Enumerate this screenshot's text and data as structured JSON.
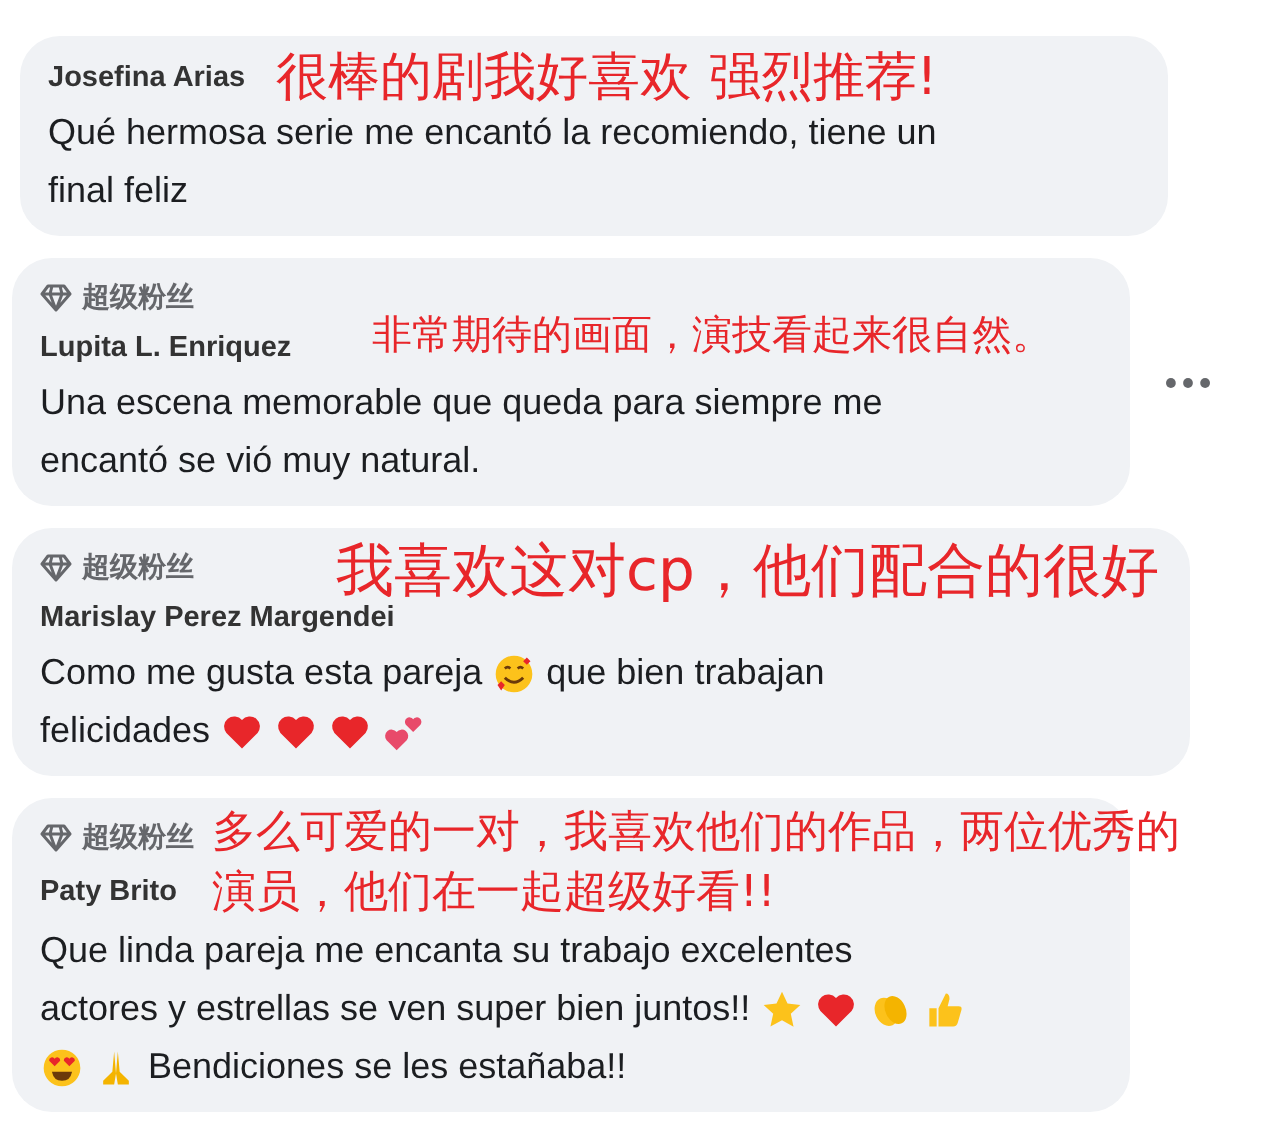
{
  "comments": [
    {
      "author": "Josefina Arias",
      "note": "很棒的剧我好喜欢 强烈推荐!",
      "more_menu": false,
      "lines": [
        [
          {
            "kind": "text",
            "text": "Qué hermosa serie me encantó la recomiendo, tiene un"
          }
        ],
        [
          {
            "kind": "text",
            "text": "final feliz"
          }
        ]
      ]
    },
    {
      "badge": "超级粉丝",
      "author": "Lupita L. Enriquez",
      "note": "非常期待的画面，演技看起来很自然。",
      "more_menu": true,
      "lines": [
        [
          {
            "kind": "text",
            "text": "Una escena memorable que queda para siempre me"
          }
        ],
        [
          {
            "kind": "text",
            "text": "encantó se vió muy natural."
          }
        ]
      ]
    },
    {
      "badge": "超级粉丝",
      "author": "Marislay Perez Margendei",
      "note": "我喜欢这对cp，他们配合的很好",
      "more_menu": false,
      "lines": [
        [
          {
            "kind": "text",
            "text": "Como me gusta esta pareja"
          },
          {
            "kind": "smiley"
          },
          {
            "kind": "text",
            "text": "que bien trabajan"
          }
        ],
        [
          {
            "kind": "text",
            "text": "felicidades"
          },
          {
            "kind": "heart"
          },
          {
            "kind": "heart"
          },
          {
            "kind": "heart"
          },
          {
            "kind": "hearts"
          }
        ]
      ]
    },
    {
      "badge": "超级粉丝",
      "author": "Paty Brito",
      "note": "多么可爱的一对，我喜欢他们的作品，两位优秀的演员，他们在一起超级好看!!",
      "more_menu": false,
      "lines": [
        [
          {
            "kind": "text",
            "text": "Que linda pareja me encanta su trabajo excelentes"
          }
        ],
        [
          {
            "kind": "text",
            "text": "actores y estrellas se ven super bien juntos!!"
          },
          {
            "kind": "star"
          },
          {
            "kind": "heart"
          },
          {
            "kind": "clap"
          },
          {
            "kind": "thumbsup"
          }
        ],
        [
          {
            "kind": "hearteyes"
          },
          {
            "kind": "pray"
          },
          {
            "kind": "text",
            "text": "Bendiciones se les estañaba!!"
          }
        ]
      ]
    }
  ]
}
